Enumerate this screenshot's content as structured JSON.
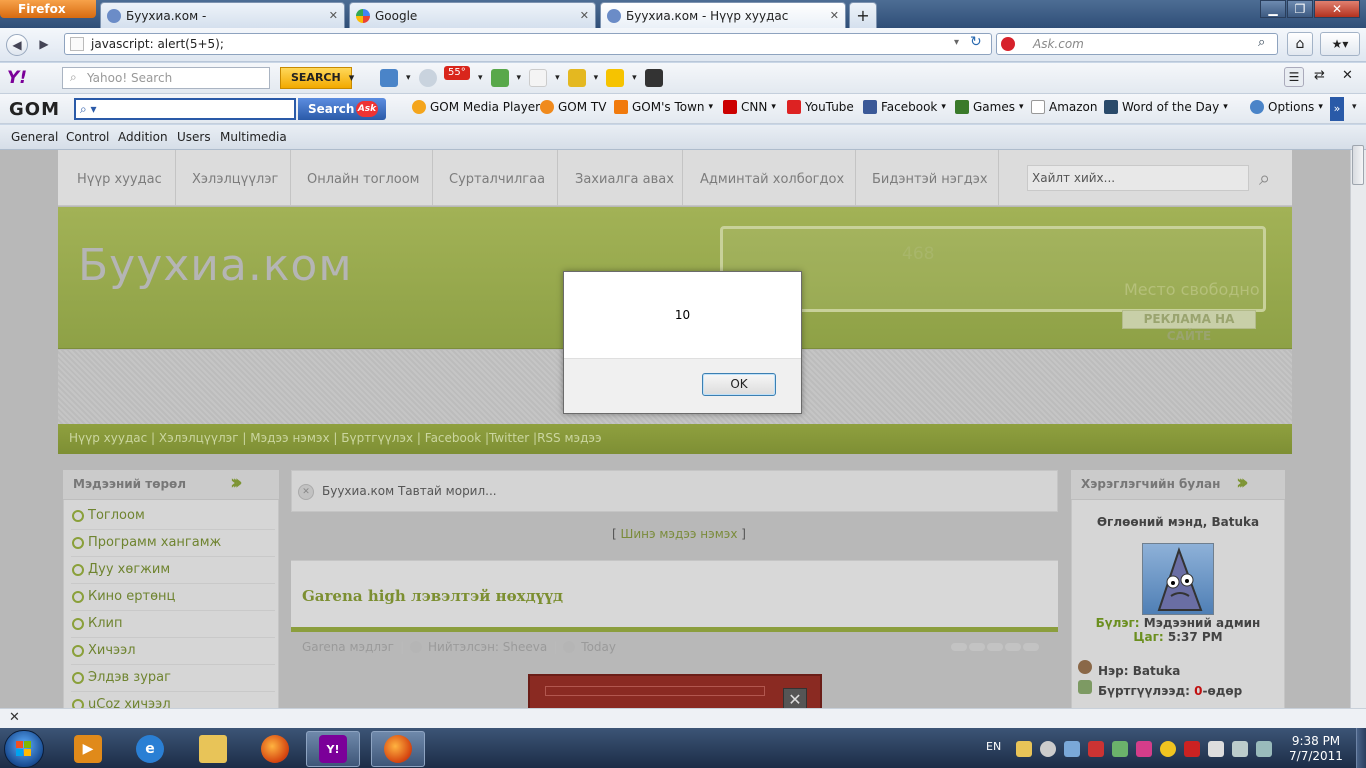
{
  "browser": {
    "menu_button": "Firefox",
    "tabs": [
      {
        "title": "Буухиа.ком -"
      },
      {
        "title": "Google"
      },
      {
        "title": "Буухиа.ком - Нүүр хуудас"
      }
    ],
    "new_tab": "+",
    "url": "javascript: alert(5+5);",
    "search_engine_placeholder": "Ask.com"
  },
  "yahoo_toolbar": {
    "logo": "Y!",
    "search_placeholder": "Yahoo! Search",
    "search_button": "SEARCH",
    "weather": "55°"
  },
  "gom_toolbar": {
    "logo": "GOM",
    "search_button": "Search",
    "links": [
      "GOM Media Player",
      "GOM TV",
      "GOM's Town",
      "CNN",
      "YouTube",
      "Facebook",
      "Games",
      "Amazon",
      "Word of the Day",
      "Options"
    ]
  },
  "menu": [
    "General",
    "Control",
    "Addition",
    "Users",
    "Multimedia"
  ],
  "site": {
    "nav": [
      "Нүүр хуудас",
      "Хэлэлцүүлэг",
      "Онлайн тоглоом",
      "Сурталчилгаа",
      "Захиалга авах",
      "Админтай холбогдох",
      "Бидэнтэй нэгдэх"
    ],
    "search_placeholder": "Хайлт хийх...",
    "logo": "Буухиа.ком",
    "ad": {
      "size": "468",
      "free_text": "Место свободно",
      "label": "РЕКЛАМА НА САЙТЕ"
    },
    "quick_links": "Нүүр хуудас | Хэлэлцүүлэг | Мэдээ нэмэх | Бүртгүүлэх | Facebook |Twitter |RSS мэдээ",
    "left_panel": {
      "title": "Мэдээний төрөл",
      "items": [
        "Тоглоом",
        "Программ хангамж",
        "Дуу хөгжим",
        "Кино ертөнц",
        "Клип",
        "Хичээл",
        "Элдэв зураг",
        "uCoz хичээл"
      ]
    },
    "center": {
      "welcome": "Буухиа.ком Тавтай морил...",
      "add_news_open": "[ ",
      "add_news": "Шинэ мэдээ нэмэх",
      "add_news_close": " ]",
      "article_title": "Garena high лэвэлтэй нөхдүүд",
      "meta_category": "Garena мэдлэг",
      "meta_author": "Нийтэлсэн: Sheeva",
      "meta_date": "Today"
    },
    "right_panel": {
      "title": "Хэрэглэгчийн булан",
      "greeting": "Өглөөний мэнд, Batuka",
      "group_label": "Бүлэг: ",
      "group_value": "Мэдээний админ",
      "time_label": "Цаг: ",
      "time_value": "5:37 PM",
      "name": "Нэр: Batuka",
      "registered_label": "Бүртгүүлээд: ",
      "registered_value": "0",
      "registered_unit": "-өдөр"
    }
  },
  "dialog": {
    "message": "10",
    "ok_button": "OK"
  },
  "taskbar": {
    "language": "EN",
    "time": "9:38 PM",
    "date": "7/7/2011"
  }
}
